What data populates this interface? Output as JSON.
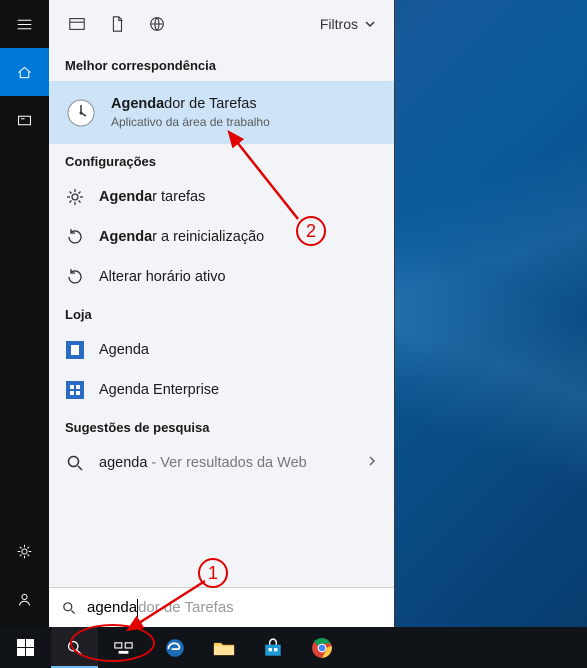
{
  "sidebar": {
    "items": [
      {
        "name": "menu-icon"
      },
      {
        "name": "home-icon",
        "active": true
      },
      {
        "name": "card-icon"
      }
    ],
    "bottom": [
      {
        "name": "settings-icon"
      },
      {
        "name": "user-icon"
      }
    ]
  },
  "header": {
    "icons": [
      "apps-icon",
      "document-icon",
      "web-icon"
    ],
    "filters_label": "Filtros"
  },
  "best_match": {
    "heading": "Melhor correspondência",
    "title_prefix": "Agenda",
    "title_rest": "dor de Tarefas",
    "subtitle": "Aplicativo da área de trabalho"
  },
  "settings_group": {
    "heading": "Configurações",
    "items": [
      {
        "bold": "Agenda",
        "rest": "r tarefas",
        "icon": "gear-icon"
      },
      {
        "bold": "Agenda",
        "rest": "r a reinicialização",
        "icon": "restart-icon"
      },
      {
        "bold": "",
        "rest": "Alterar horário ativo",
        "icon": "restart-icon"
      }
    ]
  },
  "store_group": {
    "heading": "Loja",
    "items": [
      {
        "label": "Agenda",
        "color": "#2a6cc4"
      },
      {
        "label": "Agenda Enterprise",
        "color": "#2a6cc4"
      }
    ]
  },
  "web_group": {
    "heading": "Sugestões de pesquisa",
    "query": "agenda",
    "suffix": " - Ver resultados da Web"
  },
  "search": {
    "typed": "agenda",
    "hint": "dor de Tarefas"
  },
  "taskbar": {
    "items": [
      "start",
      "search",
      "taskview",
      "edge",
      "explorer",
      "store",
      "chrome"
    ]
  },
  "annotations": {
    "step1": "1",
    "step2": "2"
  }
}
